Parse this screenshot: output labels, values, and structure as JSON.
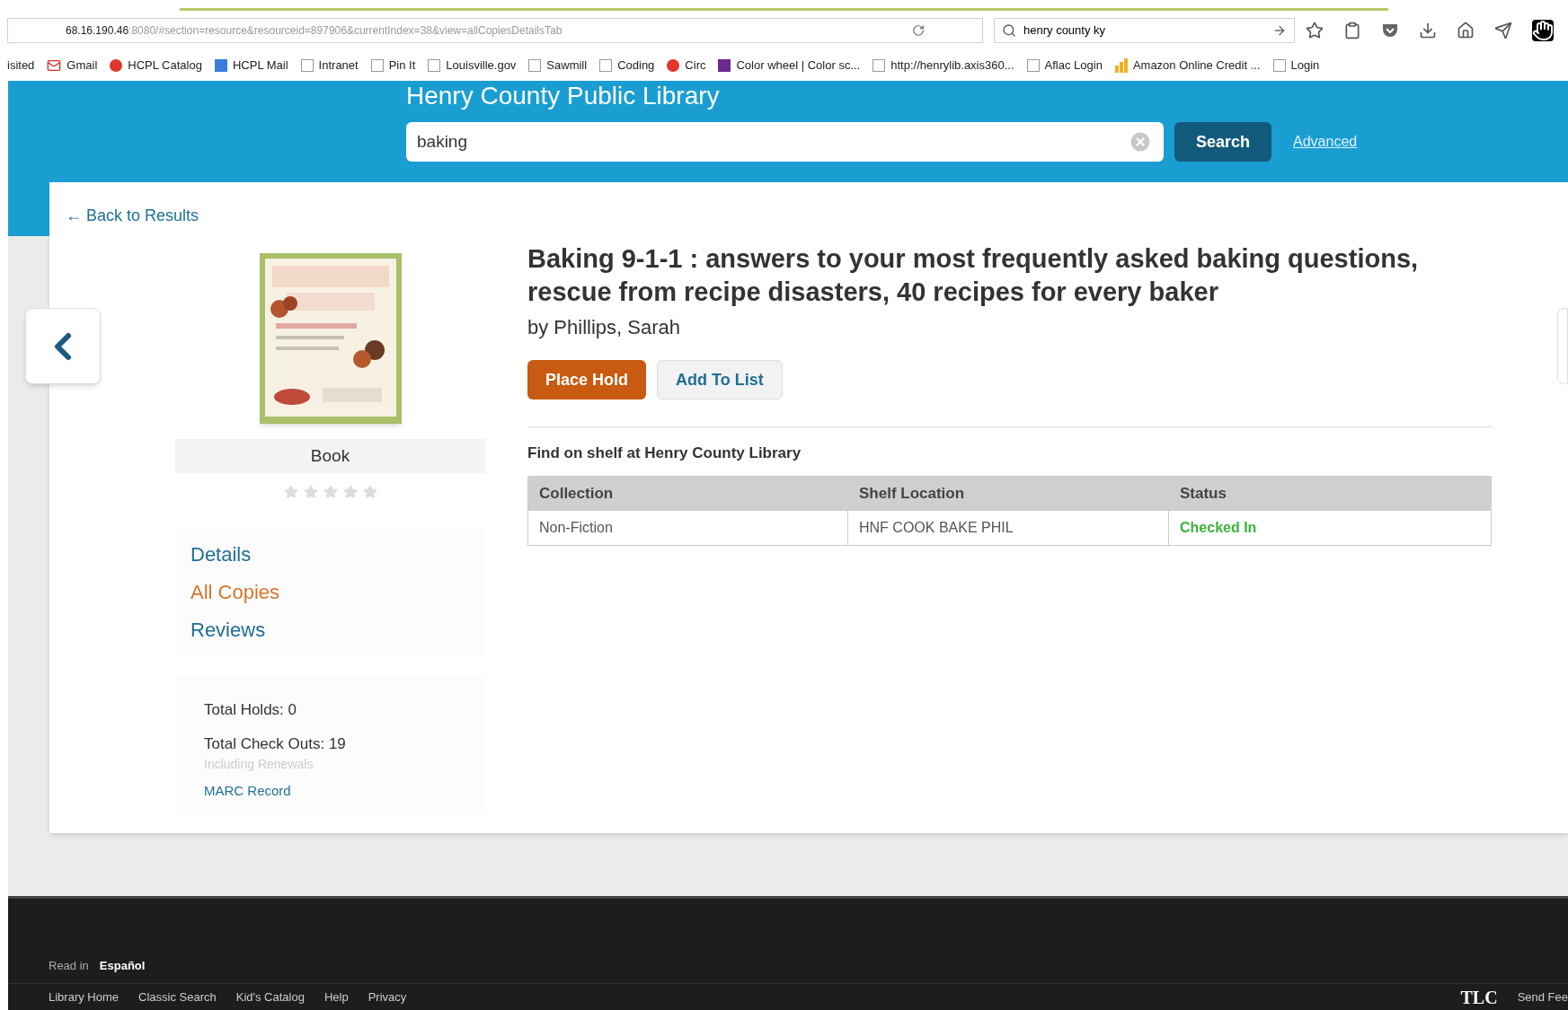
{
  "browser": {
    "url_host": "68.16.190.46",
    "url_path": ":8080/#section=resource&resourceid=897906&currentIndex=38&view=allCopiesDetailsTab",
    "search_value": "henry county ky",
    "bookmarks": [
      {
        "label": "isited",
        "kind": "plain"
      },
      {
        "label": "Gmail",
        "kind": "mail"
      },
      {
        "label": "HCPL Catalog",
        "kind": "dot"
      },
      {
        "label": "HCPL Mail",
        "kind": "gtile"
      },
      {
        "label": "Intranet",
        "kind": "page"
      },
      {
        "label": "Pin It",
        "kind": "page"
      },
      {
        "label": "Louisville.gov",
        "kind": "page"
      },
      {
        "label": "Sawmill",
        "kind": "page"
      },
      {
        "label": "Coding",
        "kind": "page"
      },
      {
        "label": "Circ",
        "kind": "dot"
      },
      {
        "label": "Color wheel | Color sc...",
        "kind": "ctile"
      },
      {
        "label": "http://henrylib.axis360...",
        "kind": "page"
      },
      {
        "label": "Aflac Login",
        "kind": "page"
      },
      {
        "label": "Amazon Online Credit ...",
        "kind": "bars"
      },
      {
        "label": "Login",
        "kind": "page"
      }
    ]
  },
  "header": {
    "title": "Henry County Public Library",
    "search_value": "baking",
    "search_button": "Search",
    "advanced_link": "Advanced"
  },
  "back_link": "← Back to Results",
  "item": {
    "format": "Book",
    "stars": 0,
    "nav": [
      {
        "label": "Details",
        "selected": false
      },
      {
        "label": "All Copies",
        "selected": true
      },
      {
        "label": "Reviews",
        "selected": false
      }
    ],
    "total_holds": "Total Holds: 0",
    "total_checkouts": "Total Check Outs: 19",
    "checkouts_note": "Including Renewals",
    "marc_link": "MARC Record",
    "title": "Baking 9-1-1 : answers to your most frequently asked baking questions, rescue from recipe disasters, 40 recipes for every baker",
    "author": "by Phillips, Sarah",
    "place_hold": "Place Hold",
    "add_to_list": "Add To List"
  },
  "shelf": {
    "heading": "Find on shelf at Henry County Library",
    "columns": [
      "Collection",
      "Shelf Location",
      "Status"
    ],
    "rows": [
      {
        "collection": "Non-Fiction",
        "location": "HNF COOK BAKE PHIL",
        "status": "Checked In",
        "kind": "available"
      }
    ]
  },
  "footer": {
    "read_in": "Read in",
    "language": "Español",
    "links": [
      "Library Home",
      "Classic Search",
      "Kid's Catalog",
      "Help",
      "Privacy"
    ],
    "logo": "TLC",
    "feedback": "Send Fee"
  }
}
